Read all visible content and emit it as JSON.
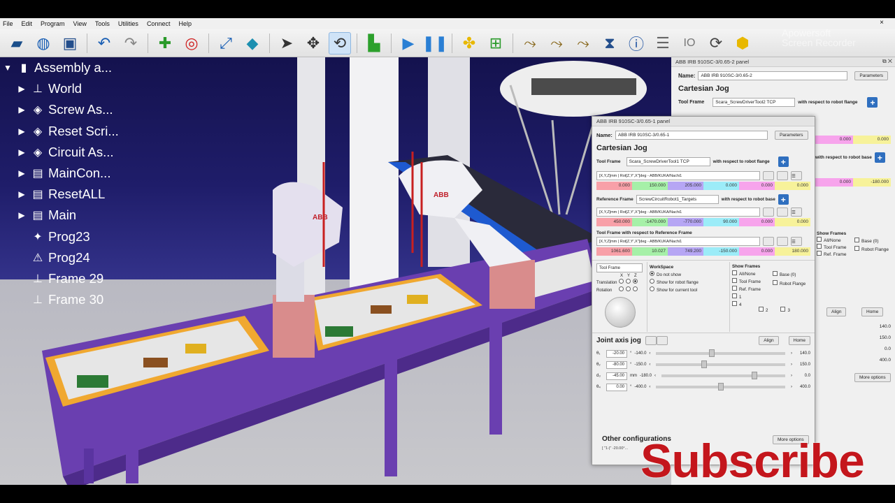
{
  "menu": [
    "File",
    "Edit",
    "Program",
    "View",
    "Tools",
    "Utilities",
    "Connect",
    "Help"
  ],
  "window_close": "×",
  "toolbar_icons": [
    "open-icon",
    "globe-icon",
    "save-icon",
    "undo-icon",
    "redo-icon",
    "add-frame-icon",
    "target-icon",
    "fit-view-icon",
    "cube-icon",
    "select-pointer-icon",
    "move-pointer-icon",
    "rotate-pointer-icon",
    "robot-icon",
    "play-icon",
    "pause-icon",
    "python-icon",
    "add-program-icon",
    "path-icon",
    "path-2-icon",
    "path-3-icon",
    "hourglass-icon",
    "info-icon",
    "list-icon",
    "io-icon",
    "sync-icon",
    "package-icon"
  ],
  "tree": {
    "items": [
      {
        "label": "Assembly a...",
        "arrow": "▼",
        "icon": "▮",
        "indent": 0
      },
      {
        "label": "World",
        "arrow": "▶",
        "icon": "⊥",
        "indent": 1
      },
      {
        "label": "Screw As...",
        "arrow": "▶",
        "icon": "◈",
        "indent": 1
      },
      {
        "label": "Reset Scri...",
        "arrow": "▶",
        "icon": "◈",
        "indent": 1
      },
      {
        "label": "Circuit As...",
        "arrow": "▶",
        "icon": "◈",
        "indent": 1
      },
      {
        "label": "MainCon...",
        "arrow": "▶",
        "icon": "▤",
        "indent": 1
      },
      {
        "label": "ResetALL",
        "arrow": "▶",
        "icon": "▤",
        "indent": 1
      },
      {
        "label": "Main",
        "arrow": "▶",
        "icon": "▤",
        "indent": 1
      },
      {
        "label": "Prog23",
        "arrow": "",
        "icon": "✦",
        "indent": 1
      },
      {
        "label": "Prog24",
        "arrow": "",
        "icon": "⚠",
        "indent": 1
      },
      {
        "label": "Frame 29",
        "arrow": "",
        "icon": "⊥",
        "indent": 1
      },
      {
        "label": "Frame 30",
        "arrow": "",
        "icon": "⊥",
        "indent": 1
      }
    ]
  },
  "watermark": {
    "line1": "Apowersoft",
    "line2": "Screen Recorder"
  },
  "subscribe": "Subscribe",
  "panel_back": {
    "title": "ABB IRB 910SC-3/0.65-2 panel",
    "name_label": "Name:",
    "name_value": "ABB IRB 910SC-3/0.65-2",
    "parameters": "Parameters",
    "heading": "Cartesian Jog",
    "tool_frame_label": "Tool Frame",
    "tool_frame_value": "Scara_ScrewDriverTool2 TCP",
    "wrt_flange": "with respect to robot flange",
    "wrt_base": "with respect to robot base",
    "row_vals1": [
      "0.000",
      "0.000"
    ],
    "row_vals2": [
      "0.000",
      "-180.000"
    ],
    "show_frames": "Show Frames",
    "all_none": "All/None",
    "tool_frame": "Tool Frame",
    "ref_frame": "Ref. Frame",
    "base0": "Base (0)",
    "robot_flange": "Robot Flange",
    "n1": "1",
    "n2": "2",
    "n3": "3",
    "n4": "4",
    "align": "Align",
    "home": "Home",
    "joint_vals": [
      "140.0",
      "150.0",
      "0.0",
      "400.0"
    ],
    "more_options": "More options"
  },
  "panel_front": {
    "title": "ABB IRB 910SC-3/0.65-1 panel",
    "name_label": "Name:",
    "name_value": "ABB IRB 910SC-3/0.65-1",
    "parameters": "Parameters",
    "heading": "Cartesian Jog",
    "tool_frame_label": "Tool Frame",
    "tool_frame_value": "Scara_ScrewDriverTool1 TCP",
    "wrt_flange": "with respect to robot flange",
    "format_select": "[X,Y,Z]mm | Rot[Z,Y',X'']deg - ABB/KUKA/Nachi1",
    "tool_vals": [
      "0.000",
      "150.000",
      "205.000",
      "0.000",
      "0.000",
      "0.000"
    ],
    "ref_frame_label": "Reference Frame",
    "ref_frame_value": "ScrewCircuitRobot1_Targets",
    "wrt_base": "with respect to robot base",
    "ref_vals": [
      "450.000",
      "-1470.000",
      "-770.000",
      "90.000",
      "0.000",
      "0.000"
    ],
    "tool_wrt_ref": "Tool Frame with respect to Reference Frame",
    "tool_ref_vals": [
      "1061.600",
      "10.027",
      "749.200",
      "-150.000",
      "0.000",
      "180.000"
    ],
    "tool_frame_select": "Tool Frame",
    "x": "X",
    "y": "Y",
    "z": "Z",
    "translation": "Translation",
    "rotation": "Rotation",
    "workspace": "WorkSpace",
    "ws_opts": [
      "Do not show",
      "Show for robot flange",
      "Show for current tool"
    ],
    "show_frames": "Show Frames",
    "all_none": "All/None",
    "tool_frame": "Tool Frame",
    "ref_frame": "Ref. Frame",
    "base0": "Base (0)",
    "robot_flange": "Robot Flange",
    "n1": "1",
    "n2": "2",
    "n3": "3",
    "n4": "4",
    "joint_heading": "Joint axis jog",
    "align": "Align",
    "home": "Home",
    "joints": [
      {
        "label": "θ₁",
        "value": "-20.00",
        "unit": "°",
        "min": "-140.0",
        "max": "140.0",
        "pos": 0.43
      },
      {
        "label": "θ₂",
        "value": "-80.00",
        "unit": "°",
        "min": "-150.0",
        "max": "150.0",
        "pos": 0.37
      },
      {
        "label": "d₃",
        "value": "-45.00",
        "unit": "mm",
        "min": "-180.0",
        "max": "0.0",
        "pos": 0.75
      },
      {
        "label": "θ₄",
        "value": "0.00",
        "unit": "°",
        "min": "-400.0",
        "max": "400.0",
        "pos": 0.5
      }
    ],
    "other_config": "Other configurations",
    "config_value": "[ \"1-|\" -20.00°...",
    "more_options": "More options"
  }
}
